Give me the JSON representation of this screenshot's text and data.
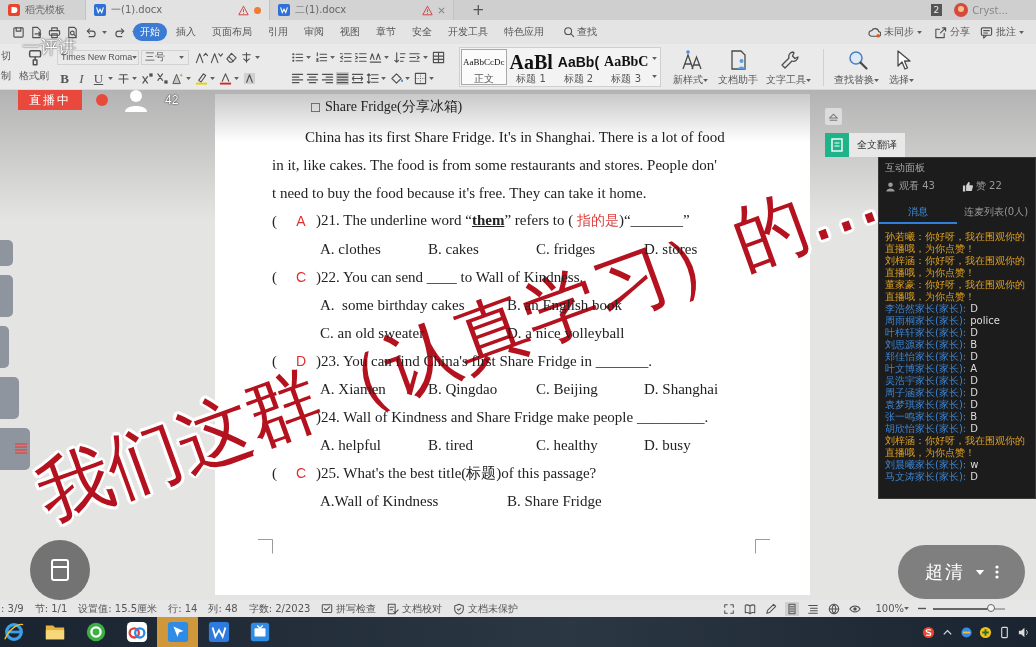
{
  "tabs": [
    {
      "label": "稻壳模板",
      "kind": "home",
      "selected": false,
      "warning": false,
      "modified": false
    },
    {
      "label": "一(1).docx",
      "kind": "doc",
      "selected": true,
      "warning": true,
      "modified": true
    },
    {
      "label": "二(1).docx",
      "kind": "doc",
      "selected": false,
      "warning": true,
      "modified": false
    }
  ],
  "new_tab": "+",
  "account": {
    "badge": "2",
    "name": "Cryst..."
  },
  "menu": [
    {
      "label": "开始",
      "selected": true
    },
    {
      "label": "插入",
      "selected": false
    },
    {
      "label": "页面布局",
      "selected": false
    },
    {
      "label": "引用",
      "selected": false
    },
    {
      "label": "审阅",
      "selected": false
    },
    {
      "label": "视图",
      "selected": false
    },
    {
      "label": "章节",
      "selected": false
    },
    {
      "label": "安全",
      "selected": false
    },
    {
      "label": "开发工具",
      "selected": false
    },
    {
      "label": "特色应用",
      "selected": false
    }
  ],
  "search": "查找",
  "cloud_actions": [
    {
      "kind": "sync",
      "label": "未同步",
      "dropdown": true
    },
    {
      "kind": "share",
      "label": "分享",
      "dropdown": false
    },
    {
      "kind": "comment",
      "label": "批注",
      "dropdown": true
    }
  ],
  "ribbon": {
    "clipboard": [
      "切",
      "制"
    ],
    "painter": "格式刷",
    "font": "Times New Roma",
    "size": "三号",
    "format_buttons": [
      {
        "kind": "bold",
        "label": "B"
      },
      {
        "kind": "italic",
        "label": "I"
      },
      {
        "kind": "underline",
        "label": "U"
      }
    ],
    "align_buttons": [
      {
        "kind": "left",
        "selected": false
      },
      {
        "kind": "center",
        "selected": false
      },
      {
        "kind": "right",
        "selected": false
      },
      {
        "kind": "justify",
        "selected": true
      },
      {
        "kind": "distribute",
        "selected": false
      }
    ],
    "styles": [
      {
        "kind": "body",
        "sample": "AaBbCcDc",
        "label": "正文",
        "selected": true
      },
      {
        "kind": "h1",
        "sample": "AaBl",
        "label": "标题 1",
        "selected": false
      },
      {
        "kind": "h2",
        "sample": "AaBb(",
        "label": "标题 2",
        "selected": false
      },
      {
        "kind": "h3",
        "sample": "AaBbC",
        "label": "标题 3",
        "selected": false
      }
    ],
    "tools": [
      {
        "kind": "style",
        "label": "新样式",
        "dropdown": true
      },
      {
        "kind": "assistant",
        "label": "文档助手",
        "dropdown": false
      },
      {
        "kind": "text_tools",
        "label": "文字工具",
        "dropdown": true
      },
      {
        "kind": "find",
        "label": "查找替换",
        "dropdown": true
      },
      {
        "kind": "select",
        "label": "选择",
        "dropdown": true
      }
    ]
  },
  "live": {
    "status": "直播中",
    "recording": true,
    "viewers": "42"
  },
  "document": {
    "heading": "Share Fridge(分享冰箱)",
    "paragraph": [
      "China has its first Share Fridge. It's in Shanghai. There is a lot of food",
      "in it, like cakes. The food is from some restaurants and stores. People don'",
      "t need to buy the food because it's free. They can take it home."
    ],
    "questions": [
      {
        "open": "(",
        "answer": "A",
        "stem": [
          {
            "kind": "text",
            "text": ")21. The underline word “"
          },
          {
            "kind": "keyword",
            "text": "them"
          },
          {
            "kind": "text",
            "text": "” refers to ( "
          },
          {
            "kind": "note",
            "text": "指的是"
          },
          {
            "kind": "text",
            "text": ")“_______”"
          }
        ],
        "option_rows": [
          [
            "A. clothes",
            "B. cakes",
            "C. fridges",
            "D. stores"
          ]
        ]
      },
      {
        "open": "(",
        "answer": "C",
        "stem": [
          {
            "kind": "text",
            "text": ")22. You can send ____ to Wall of Kindness."
          }
        ],
        "option_rows": [
          [
            "A.  some birthday cakes",
            "B. an English book"
          ],
          [
            "C. an old sweater",
            "D. a nice volleyball"
          ]
        ]
      },
      {
        "open": "(",
        "answer": "D",
        "stem": [
          {
            "kind": "text",
            "text": ")23. You can find China's first Share Fridge in _______."
          }
        ],
        "option_rows": [
          [
            "A. Xiamen",
            "B. Qingdao",
            "C. Beijing",
            "D. Shanghai"
          ]
        ]
      },
      {
        "stem": [
          {
            "kind": "text",
            "text": ")24. Wall of Kindness and Share Fridge make people _________."
          }
        ],
        "option_rows": [
          [
            "A. helpful",
            "B. tired",
            "C. healthy",
            "D. busy"
          ]
        ]
      },
      {
        "open": "(",
        "answer": "C",
        "stem": [
          {
            "kind": "text",
            "text": ")25. What's the best title(标题)of this passage?"
          }
        ],
        "option_rows": [
          [
            "A.Wall of Kindness",
            "B. Share Fridge"
          ]
        ]
      }
    ]
  },
  "side_panel": {
    "translate": "全文翻译"
  },
  "chat": {
    "title": "互动面板",
    "viewers": "观看 43",
    "likes": "赞 22",
    "tabs": [
      {
        "label": "消息",
        "selected": true
      },
      {
        "label": "连麦列表(0人)",
        "selected": false
      }
    ],
    "messages": [
      {
        "kind": "system",
        "text": "孙若曦：你好呀，我在围观你的直播哦，为你点赞！"
      },
      {
        "kind": "system",
        "text": "刘梓涵：你好呀，我在围观你的直播哦，为你点赞！"
      },
      {
        "kind": "system",
        "text": "董家豪：你好呀，我在围观你的直播哦，为你点赞！"
      },
      {
        "kind": "answer",
        "sender": "李浩然家长(家长):",
        "text": "D"
      },
      {
        "kind": "answer",
        "sender": "周雨桐家长(家长):",
        "text": "police"
      },
      {
        "kind": "answer",
        "sender": "叶梓轩家长(家长):",
        "text": "D"
      },
      {
        "kind": "answer",
        "sender": "刘思源家长(家长):",
        "text": "B"
      },
      {
        "kind": "answer",
        "sender": "郑佳怡家长(家长):",
        "text": "D"
      },
      {
        "kind": "answer",
        "sender": "叶文博家长(家长):",
        "text": "A"
      },
      {
        "kind": "answer",
        "sender": "吴浩宇家长(家长):",
        "text": "D"
      },
      {
        "kind": "answer",
        "sender": "周子涵家长(家长):",
        "text": "D"
      },
      {
        "kind": "answer",
        "sender": "袁梦琪家长(家长):",
        "text": "D"
      },
      {
        "kind": "answer",
        "sender": "张一鸣家长(家长):",
        "text": "B"
      },
      {
        "kind": "answer",
        "sender": "胡欣怡家长(家长):",
        "text": "D"
      },
      {
        "kind": "system",
        "text": "刘梓涵：你好呀，我在围观你的直播哦，为你点赞！"
      },
      {
        "kind": "answer",
        "sender": "刘晨曦家长(家长):",
        "text": "w"
      },
      {
        "kind": "answer",
        "sender": "马文涛家长(家长):",
        "text": "D"
      }
    ]
  },
  "status_bar": {
    "items": [
      {
        "kind": "text",
        "label": ": 3/9"
      },
      {
        "kind": "text",
        "label": "节: 1/1"
      },
      {
        "kind": "text",
        "label": "设置值: 15.5厘米"
      },
      {
        "kind": "text",
        "label": "行: 14"
      },
      {
        "kind": "text",
        "label": "列: 48"
      },
      {
        "kind": "text",
        "label": "字数: 2/2023"
      },
      {
        "kind": "spell",
        "label": "拼写检查"
      },
      {
        "kind": "proofread",
        "label": "文档校对"
      },
      {
        "kind": "protect",
        "label": "文档未保护"
      }
    ],
    "views": [
      {
        "kind": "fullscreen",
        "selected": false
      },
      {
        "kind": "read",
        "selected": false
      },
      {
        "kind": "write",
        "selected": false
      },
      {
        "kind": "page",
        "selected": true
      },
      {
        "kind": "outline",
        "selected": false
      },
      {
        "kind": "web",
        "selected": false
      },
      {
        "kind": "eye",
        "selected": false
      }
    ],
    "zoom": "100%",
    "zoom_slider": {
      "level": 0.8
    }
  },
  "player": {
    "quality": "超清"
  },
  "overlay": {
    "note": "一评讲",
    "caption": "我们这群（认真学习）的…"
  },
  "taskbar": {
    "apps": [
      {
        "kind": "ie",
        "selected": false
      },
      {
        "kind": "folder",
        "selected": false
      },
      {
        "kind": "browser",
        "selected": false
      },
      {
        "kind": "cloud",
        "selected": false
      },
      {
        "kind": "arrow",
        "selected": true
      },
      {
        "kind": "wps",
        "selected": false
      },
      {
        "kind": "tv",
        "selected": false
      }
    ]
  }
}
